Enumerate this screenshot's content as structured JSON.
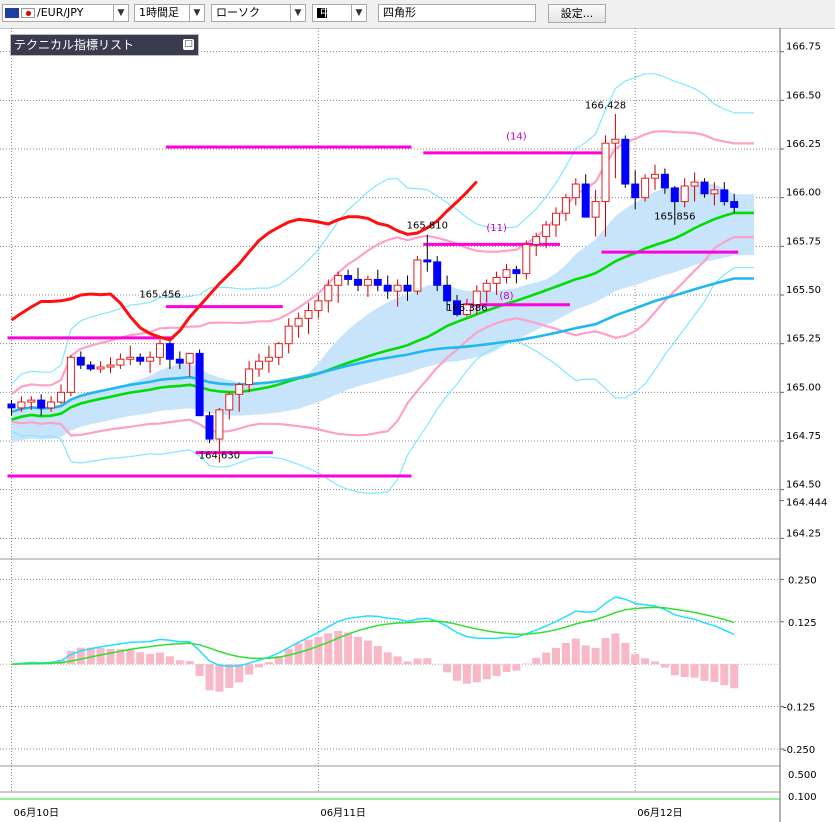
{
  "toolbar": {
    "symbol": "/EUR/JPY",
    "timeframe": "1時間足",
    "chart_type": "ローソク",
    "line_width": "中",
    "drawing_tool": "四角形",
    "settings_label": "設定..."
  },
  "indicator_panel": {
    "title": "テクニカル指標リスト",
    "close_label": "□"
  },
  "colors": {
    "up_candle": "#e02020",
    "down_candle": "#0000ff",
    "bb_outer": "#80e8ff",
    "bb_inner": "#ffa0c8",
    "ma_green": "#00dd00",
    "ma_blue": "#20b8f0",
    "cloud": "#c8e4fa",
    "trend_red": "#ff1010",
    "zone_magenta": "#ff00dd",
    "macd_hist": "#f8b8c8",
    "macd_line": "#20e0ff",
    "signal_line": "#30e030"
  },
  "chart_data": {
    "type": "candlestick",
    "symbol": "EUR/JPY",
    "interval": "1時間足",
    "ylim": [
      164.19,
      166.81
    ],
    "y_ticks": [
      "166.75",
      "166.50",
      "166.25",
      "166.00",
      "165.75",
      "165.50",
      "165.25",
      "165.00",
      "164.75",
      "164.50",
      "164.444",
      "164.25"
    ],
    "current_price": "164.444",
    "x_labels": [
      {
        "label": "06月10日",
        "index": 0
      },
      {
        "label": "06月11日",
        "index": 31
      },
      {
        "label": "06月12日",
        "index": 63
      }
    ],
    "candles": [
      [
        164.94,
        164.96,
        164.88,
        164.92
      ],
      [
        164.92,
        164.98,
        164.9,
        164.95
      ],
      [
        164.95,
        164.98,
        164.91,
        164.96
      ],
      [
        164.96,
        164.99,
        164.88,
        164.92
      ],
      [
        164.92,
        164.98,
        164.9,
        164.95
      ],
      [
        164.95,
        165.04,
        164.94,
        165.0
      ],
      [
        165.0,
        165.19,
        164.98,
        165.18
      ],
      [
        165.18,
        165.21,
        165.12,
        165.14
      ],
      [
        165.14,
        165.16,
        165.11,
        165.12
      ],
      [
        165.12,
        165.16,
        165.1,
        165.13
      ],
      [
        165.13,
        165.18,
        165.1,
        165.14
      ],
      [
        165.14,
        165.2,
        165.12,
        165.17
      ],
      [
        165.17,
        165.24,
        165.14,
        165.18
      ],
      [
        165.18,
        165.2,
        165.14,
        165.16
      ],
      [
        165.16,
        165.21,
        165.1,
        165.18
      ],
      [
        165.18,
        165.27,
        165.14,
        165.25
      ],
      [
        165.25,
        165.28,
        165.12,
        165.17
      ],
      [
        165.17,
        165.21,
        165.12,
        165.15
      ],
      [
        165.15,
        165.2,
        165.08,
        165.2
      ],
      [
        165.2,
        165.22,
        164.88,
        164.88
      ],
      [
        164.88,
        164.9,
        164.74,
        164.76
      ],
      [
        164.76,
        164.92,
        164.64,
        164.91
      ],
      [
        164.91,
        165.0,
        164.86,
        164.99
      ],
      [
        164.99,
        165.05,
        164.9,
        165.04
      ],
      [
        165.04,
        165.16,
        165.0,
        165.12
      ],
      [
        165.12,
        165.2,
        165.08,
        165.16
      ],
      [
        165.16,
        165.24,
        165.1,
        165.18
      ],
      [
        165.18,
        165.26,
        165.14,
        165.25
      ],
      [
        165.25,
        165.38,
        165.2,
        165.34
      ],
      [
        165.34,
        165.41,
        165.28,
        165.38
      ],
      [
        165.38,
        165.46,
        165.3,
        165.42
      ],
      [
        165.42,
        165.5,
        165.38,
        165.47
      ],
      [
        165.47,
        165.58,
        165.41,
        165.55
      ],
      [
        165.55,
        165.62,
        165.46,
        165.6
      ],
      [
        165.6,
        165.63,
        165.55,
        165.58
      ],
      [
        165.58,
        165.64,
        165.52,
        165.55
      ],
      [
        165.55,
        165.6,
        165.49,
        165.58
      ],
      [
        165.58,
        165.63,
        165.52,
        165.55
      ],
      [
        165.55,
        165.6,
        165.48,
        165.52
      ],
      [
        165.52,
        165.58,
        165.44,
        165.55
      ],
      [
        165.55,
        165.6,
        165.47,
        165.52
      ],
      [
        165.52,
        165.7,
        165.5,
        165.68
      ],
      [
        165.68,
        165.81,
        165.62,
        165.67
      ],
      [
        165.67,
        165.7,
        165.52,
        165.55
      ],
      [
        165.55,
        165.6,
        165.42,
        165.47
      ],
      [
        165.47,
        165.5,
        165.39,
        165.4
      ],
      [
        165.4,
        165.48,
        165.39,
        165.45
      ],
      [
        165.45,
        165.55,
        165.4,
        165.52
      ],
      [
        165.52,
        165.58,
        165.46,
        165.56
      ],
      [
        165.56,
        165.62,
        165.5,
        165.59
      ],
      [
        165.59,
        165.66,
        165.56,
        165.63
      ],
      [
        165.63,
        165.65,
        165.56,
        165.61
      ],
      [
        165.61,
        165.78,
        165.58,
        165.76
      ],
      [
        165.76,
        165.82,
        165.7,
        165.8
      ],
      [
        165.8,
        165.88,
        165.74,
        165.86
      ],
      [
        165.86,
        165.95,
        165.8,
        165.92
      ],
      [
        165.92,
        166.02,
        165.88,
        166.0
      ],
      [
        166.0,
        166.1,
        165.96,
        166.07
      ],
      [
        166.07,
        166.12,
        165.9,
        165.9
      ],
      [
        165.9,
        166.04,
        165.8,
        165.98
      ],
      [
        165.98,
        166.32,
        165.8,
        166.28
      ],
      [
        166.28,
        166.43,
        166.1,
        166.3
      ],
      [
        166.3,
        166.32,
        166.05,
        166.07
      ],
      [
        166.07,
        166.14,
        165.94,
        166.0
      ],
      [
        166.0,
        166.12,
        165.98,
        166.1
      ],
      [
        166.1,
        166.17,
        166.04,
        166.12
      ],
      [
        166.12,
        166.15,
        166.02,
        166.05
      ],
      [
        166.05,
        166.06,
        165.86,
        165.98
      ],
      [
        165.98,
        166.1,
        165.95,
        166.06
      ],
      [
        166.06,
        166.13,
        165.98,
        166.08
      ],
      [
        166.08,
        166.1,
        166.0,
        166.02
      ],
      [
        166.02,
        166.08,
        165.96,
        166.04
      ],
      [
        166.04,
        166.08,
        165.96,
        165.98
      ],
      [
        165.98,
        166.02,
        165.92,
        165.95
      ]
    ],
    "annotations": [
      {
        "text": "165.456",
        "price": 165.456,
        "index": 15
      },
      {
        "text": "164.630",
        "price": 164.63,
        "index": 21
      },
      {
        "text": "165.810",
        "price": 165.81,
        "index": 42
      },
      {
        "text": "165.386",
        "price": 165.386,
        "index": 46
      },
      {
        "text": "166.428",
        "price": 166.428,
        "index": 60
      },
      {
        "text": "165.856",
        "price": 165.856,
        "index": 67
      },
      {
        "text": "(14)",
        "price": 166.3,
        "index": 51
      },
      {
        "text": "(11)",
        "price": 165.83,
        "index": 49
      },
      {
        "text": "(8)",
        "price": 165.48,
        "index": 50
      }
    ],
    "zones": [
      {
        "price": 166.26,
        "from": 16,
        "to": 40
      },
      {
        "price": 166.23,
        "from": 42,
        "to": 60
      },
      {
        "price": 165.76,
        "from": 42,
        "to": 55
      },
      {
        "price": 165.72,
        "from": 60,
        "to": 73
      },
      {
        "price": 165.45,
        "from": 46,
        "to": 56
      },
      {
        "price": 165.44,
        "from": 16,
        "to": 27
      },
      {
        "price": 165.28,
        "from": 0,
        "to": 16
      },
      {
        "price": 164.69,
        "from": 19,
        "to": 26
      },
      {
        "price": 164.57,
        "from": 0,
        "to": 40
      }
    ],
    "indicator": {
      "ylim": [
        -0.3,
        0.31
      ],
      "y_ticks": [
        "0.250",
        "0.125",
        "-0.125",
        "-0.250"
      ]
    },
    "lower_panel": {
      "y_ticks": [
        "0.500",
        "0.100"
      ]
    }
  }
}
